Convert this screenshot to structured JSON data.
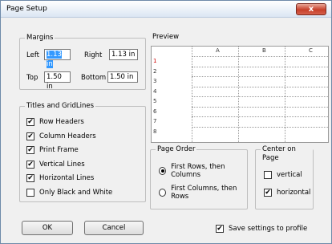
{
  "dialog": {
    "title": "Page Setup",
    "close_label": "x"
  },
  "margins": {
    "label": "Margins",
    "left_label": "Left",
    "left_value": "1.13 in",
    "right_label": "Right",
    "right_value": "1.13 in",
    "top_label": "Top",
    "top_value": "1.50 in",
    "bottom_label": "Bottom",
    "bottom_value": "1.50 in"
  },
  "titles": {
    "label": "Titles and GridLines",
    "items": [
      {
        "label": "Row Headers",
        "checked": true
      },
      {
        "label": "Column Headers",
        "checked": true
      },
      {
        "label": "Print Frame",
        "checked": true
      },
      {
        "label": "Vertical Lines",
        "checked": true
      },
      {
        "label": "Horizontal Lines",
        "checked": true
      },
      {
        "label": "Only Black and White",
        "checked": false
      }
    ]
  },
  "preview": {
    "label": "Preview",
    "columns": [
      "A",
      "B",
      "C"
    ],
    "rows": [
      "1",
      "2",
      "3",
      "4",
      "5",
      "6",
      "7",
      "8"
    ]
  },
  "page_order": {
    "label": "Page Order",
    "options": [
      {
        "label": "First Rows, then Columns",
        "selected": true
      },
      {
        "label": "First Columns, then Rows",
        "selected": false
      }
    ]
  },
  "center": {
    "label": "Center on Page",
    "vertical_label": "vertical",
    "vertical_checked": false,
    "horizontal_label": "horizontal",
    "horizontal_checked": true
  },
  "buttons": {
    "ok_label": "OK",
    "cancel_label": "Cancel"
  },
  "save": {
    "label": "Save settings to profile",
    "checked": true
  },
  "check_mark": "✔"
}
